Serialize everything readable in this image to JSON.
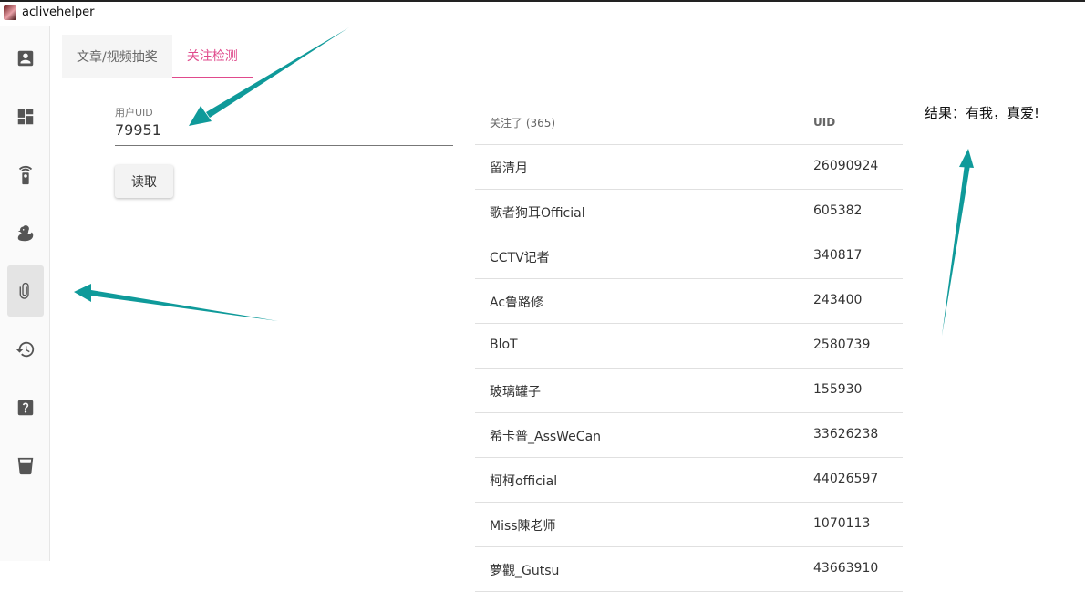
{
  "window": {
    "title": "aclivehelper"
  },
  "sidebar": {
    "items": [
      {
        "icon": "account-box-icon"
      },
      {
        "icon": "dashboard-icon"
      },
      {
        "icon": "remote-icon"
      },
      {
        "icon": "duck-icon"
      },
      {
        "icon": "paperclip-icon",
        "active": true
      },
      {
        "icon": "history-icon"
      },
      {
        "icon": "help-icon"
      },
      {
        "icon": "cup-icon"
      }
    ]
  },
  "tabs": [
    {
      "label": "文章/视频抽奖"
    },
    {
      "label": "关注检测",
      "active": true
    }
  ],
  "uid_field": {
    "label": "用户UID",
    "value": "79951"
  },
  "read_button": {
    "label": "读取"
  },
  "table": {
    "headers": {
      "name": "关注了 (365)",
      "uid": "UID"
    },
    "rows": [
      {
        "name": "留清月",
        "uid": "26090924"
      },
      {
        "name": "歌者狗耳Official",
        "uid": "605382"
      },
      {
        "name": "CCTV记者",
        "uid": "340817"
      },
      {
        "name": "Ac鲁路修",
        "uid": "243400"
      },
      {
        "name": "BloT",
        "uid": "2580739"
      },
      {
        "name": "玻璃罐子",
        "uid": "155930"
      },
      {
        "name": "希卡普_AssWeCan",
        "uid": "33626238"
      },
      {
        "name": "柯柯official",
        "uid": "44026597"
      },
      {
        "name": "Miss陳老师",
        "uid": "1070113"
      },
      {
        "name": "夢觀_Gutsu",
        "uid": "43663910"
      }
    ]
  },
  "result_text": "结果：有我，真爱!",
  "colors": {
    "accent": "#e04a8c",
    "annotation_arrow": "#0f9a9a"
  }
}
